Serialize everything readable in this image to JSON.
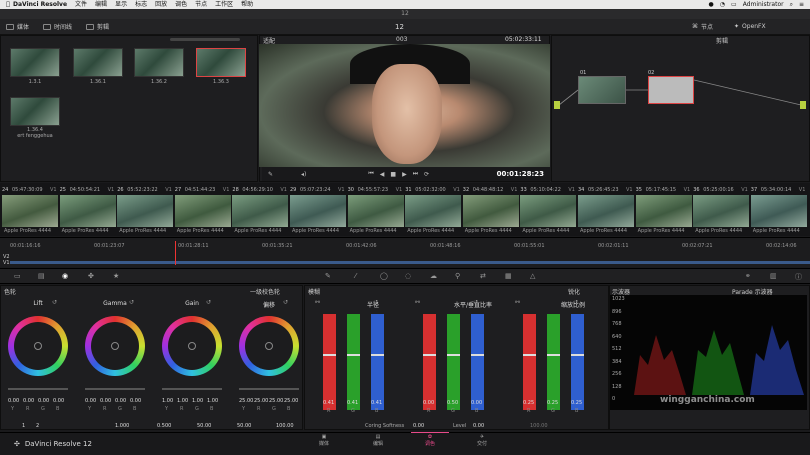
{
  "menubar": {
    "apple": "",
    "app_name": "DaVinci Resolve",
    "items": [
      "文件",
      "编辑",
      "显示",
      "标志",
      "回放",
      "调色",
      "节点",
      "工作区",
      "帮助"
    ],
    "user": "Administrator"
  },
  "title": "12",
  "toolbar": {
    "media": "媒体",
    "timeline": "时间线",
    "edit": "剪辑",
    "center_title": "12",
    "nodes": "节点",
    "openfx": "OpenFX"
  },
  "media_pool": {
    "clips": [
      {
        "label": "1.3.1",
        "selected": false
      },
      {
        "label": "1.36.1",
        "selected": false
      },
      {
        "label": "1.36.2",
        "selected": false
      },
      {
        "label": "1.36.3",
        "selected": true
      },
      {
        "label": "1.36.4",
        "sublabel": "ert fenggehua",
        "selected": false
      }
    ]
  },
  "viewer": {
    "header_left": "适配",
    "header_center": "003",
    "timecode_top": "05:02:33:11",
    "timecode": "00:01:28:23"
  },
  "node_editor": {
    "title": "剪辑",
    "nodes": [
      "01",
      "02"
    ]
  },
  "clips_strip": [
    {
      "num": "24",
      "tc": "05:47:30:09",
      "track": "V1",
      "codec": "Apple ProRes 4444"
    },
    {
      "num": "25",
      "tc": "04:50:54:21",
      "track": "V1",
      "codec": "Apple ProRes 4444"
    },
    {
      "num": "26",
      "tc": "05:52:23:22",
      "track": "V1",
      "codec": "Apple ProRes 4444"
    },
    {
      "num": "27",
      "tc": "04:51:44:23",
      "track": "V1",
      "codec": "Apple ProRes 4444"
    },
    {
      "num": "28",
      "tc": "04:56:29:10",
      "track": "V1",
      "codec": "Apple ProRes 4444"
    },
    {
      "num": "29",
      "tc": "05:07:23:24",
      "track": "V1",
      "codec": "Apple ProRes 4444"
    },
    {
      "num": "30",
      "tc": "04:55:57:23",
      "track": "V1",
      "codec": "Apple ProRes 4444"
    },
    {
      "num": "31",
      "tc": "05:02:32:00",
      "track": "V1",
      "codec": "Apple ProRes 4444"
    },
    {
      "num": "32",
      "tc": "04:48:48:12",
      "track": "V1",
      "codec": "Apple ProRes 4444"
    },
    {
      "num": "33",
      "tc": "05:10:04:22",
      "track": "V1",
      "codec": "Apple ProRes 4444"
    },
    {
      "num": "34",
      "tc": "05:26:45:23",
      "track": "V1",
      "codec": "Apple ProRes 4444"
    },
    {
      "num": "35",
      "tc": "05:17:45:15",
      "track": "V1",
      "codec": "Apple ProRes 4444"
    },
    {
      "num": "36",
      "tc": "05:25:00:16",
      "track": "V1",
      "codec": "Apple ProRes 4444"
    },
    {
      "num": "37",
      "tc": "05:34:00:14",
      "track": "V1",
      "codec": "Apple ProRes 4444"
    }
  ],
  "timeline_ruler": [
    "00:01:16:16",
    "00:01:23:07",
    "00:01:28:11",
    "00:01:35:21",
    "00:01:42:06",
    "00:01:48:16",
    "00:01:55:01",
    "00:02:01:11",
    "00:02:07:21",
    "00:02:14:06"
  ],
  "tracks": [
    "V2",
    "V1"
  ],
  "color_wheels": {
    "title": "色轮",
    "mode": "一级校色轮",
    "wheels": [
      {
        "name": "Lift",
        "values": [
          "0.00",
          "0.00",
          "0.00",
          "0.00"
        ]
      },
      {
        "name": "Gamma",
        "values": [
          "0.00",
          "0.00",
          "0.00",
          "0.00"
        ]
      },
      {
        "name": "Gain",
        "values": [
          "1.00",
          "1.00",
          "1.00",
          "1.00"
        ]
      },
      {
        "name": "偏移",
        "values": [
          "25.00",
          "25.00",
          "25.00",
          "25.00"
        ]
      }
    ],
    "channel_labels": [
      "Y",
      "R",
      "G",
      "B"
    ],
    "bottom": [
      "1",
      "2",
      "1.000",
      "0.500",
      "50.00",
      "50.00",
      "100.00"
    ]
  },
  "blur": {
    "title": "模糊",
    "sharpen": "锐化",
    "groups": [
      {
        "name": "半径",
        "values": [
          "0.41",
          "0.41",
          "0.41"
        ]
      },
      {
        "name": "水平/垂直比率",
        "values": [
          "0.00",
          "0.50",
          "0.00"
        ]
      },
      {
        "name": "缩放比例",
        "values": [
          "0.25",
          "0.25",
          "0.25"
        ]
      }
    ],
    "rgb": [
      "R",
      "G",
      "B"
    ],
    "coring_label": "Coring Softness",
    "coring": "0.00",
    "level_label": "Level",
    "level": "0.00",
    "mix": "100.00"
  },
  "scopes": {
    "title": "示波器",
    "mode": "Parade 示波器",
    "ticks": [
      "1023",
      "896",
      "768",
      "640",
      "512",
      "384",
      "256",
      "128",
      "0"
    ]
  },
  "bottom_nav": {
    "app": "DaVinci Resolve 12",
    "tabs": [
      "媒体",
      "编辑",
      "调色",
      "交付"
    ],
    "active": "调色"
  },
  "watermark": "wingganchina.com",
  "colors": {
    "accent": "#e84a8a",
    "red": "#d63030",
    "green": "#2aa02a",
    "blue": "#2f5fd0"
  }
}
